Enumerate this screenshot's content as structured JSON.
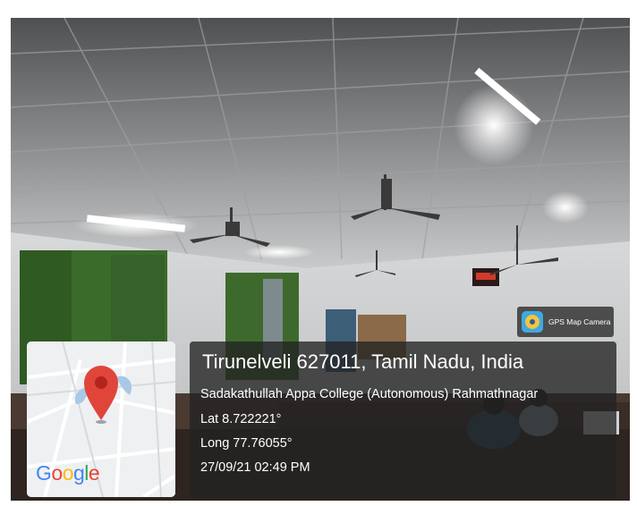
{
  "watermark": {
    "app_name": "GPS Map Camera",
    "icon": "gps-map-camera-icon"
  },
  "location": {
    "title": "Tirunelveli 627011, Tamil Nadu, India",
    "place": "Sadakathullah Appa College (Autonomous) Rahmathnagar",
    "latitude": "Lat 8.722221°",
    "longitude": "Long 77.76055°",
    "timestamp": "27/09/21 02:49 PM"
  },
  "map": {
    "logo_letters": [
      "G",
      "o",
      "o",
      "g",
      "l",
      "e"
    ],
    "pin_icon": "map-pin-icon",
    "colors": {
      "pin": "#e0453a",
      "panel": "#232323"
    }
  }
}
